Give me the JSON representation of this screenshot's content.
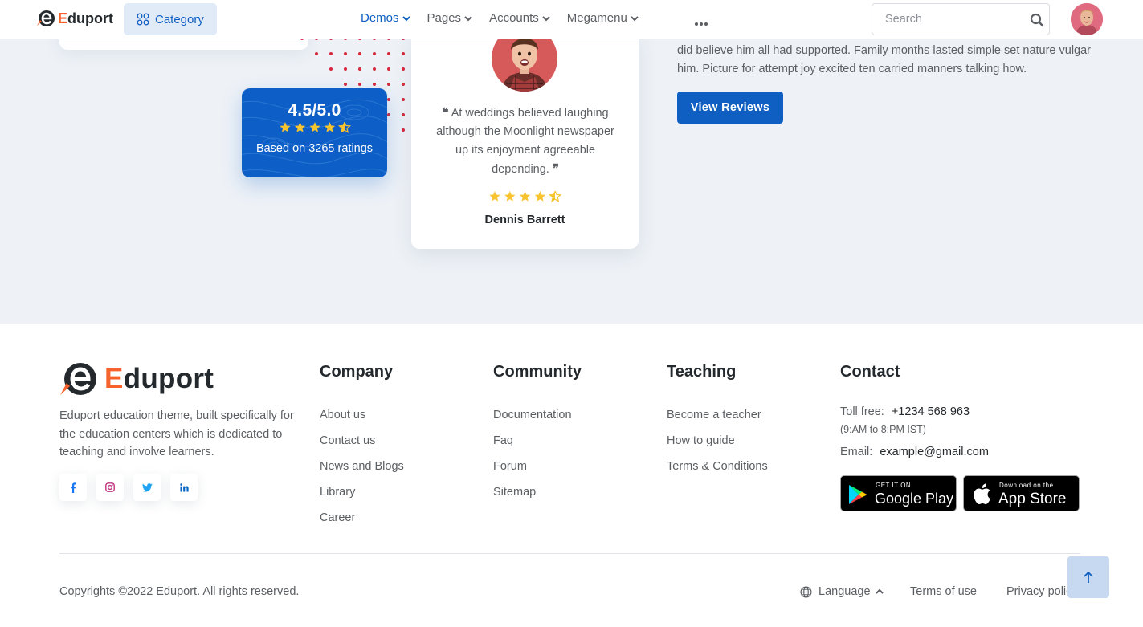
{
  "navbar": {
    "brand_prefix": "E",
    "brand_rest": "duport",
    "category_label": "Category",
    "menu": [
      {
        "label": "Demos",
        "active": true
      },
      {
        "label": "Pages",
        "active": false
      },
      {
        "label": "Accounts",
        "active": false
      },
      {
        "label": "Megamenu",
        "active": false
      }
    ],
    "more_icon": "more-dots-icon",
    "search_placeholder": "Search"
  },
  "rating_card": {
    "score": "4.5/5.0",
    "stars": 4.5,
    "based_on": "Based on 3265 ratings"
  },
  "testimonial": {
    "quote": "At weddings believed laughing although the Moonlight newspaper up its enjoyment agreeable depending.",
    "stars": 4.5,
    "name": "Dennis Barrett"
  },
  "about": {
    "text": "did believe him all had supported. Family months lasted simple set nature vulgar him. Picture for attempt joy excited ten carried manners talking how.",
    "button_label": "View Reviews"
  },
  "footer": {
    "brand_prefix": "E",
    "brand_rest": "duport",
    "description": "Eduport education theme, built specifically for the education centers which is dedicated to teaching and involve learners.",
    "socials": [
      {
        "name": "facebook",
        "glyph": "f",
        "color": "#1877f2"
      },
      {
        "name": "instagram",
        "glyph": "◎",
        "color": "#c13584"
      },
      {
        "name": "twitter",
        "glyph": "🐦",
        "color": "#1da1f2"
      },
      {
        "name": "linkedin",
        "glyph": "in",
        "color": "#0a66c2"
      }
    ],
    "company": {
      "title": "Company",
      "links": [
        "About us",
        "Contact us",
        "News and Blogs",
        "Library",
        "Career"
      ]
    },
    "community": {
      "title": "Community",
      "links": [
        "Documentation",
        "Faq",
        "Forum",
        "Sitemap"
      ]
    },
    "teaching": {
      "title": "Teaching",
      "links": [
        "Become a teacher",
        "How to guide",
        "Terms & Conditions"
      ]
    },
    "contact": {
      "title": "Contact",
      "tollfree_label": "Toll free:",
      "tollfree_value": "+1234 568 963",
      "hours": "(9:AM to 8:PM IST)",
      "email_label": "Email:",
      "email_value": "example@gmail.com",
      "google_small": "GET IT ON",
      "google_big": "Google Play",
      "apple_small": "Download on the",
      "apple_big": "App Store"
    },
    "copyright": "Copyrights ©2022 Eduport. All rights reserved.",
    "language_label": "Language",
    "terms_label": "Terms of use",
    "privacy_label": "Privacy policy"
  }
}
